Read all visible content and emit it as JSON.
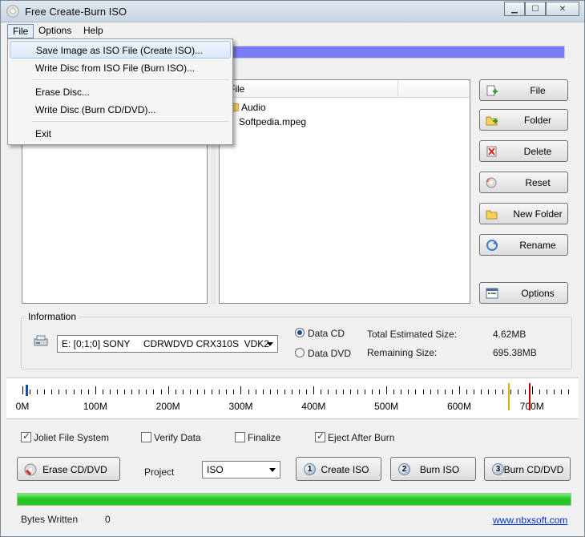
{
  "window": {
    "title": "Free Create-Burn ISO",
    "min": "▁",
    "max": "☐",
    "close": "✕"
  },
  "menu": {
    "file": "File",
    "options": "Options",
    "help": "Help"
  },
  "file_menu": {
    "items": [
      "Save Image as ISO File (Create ISO)...",
      "Write Disc from ISO File (Burn ISO)...",
      "Erase Disc...",
      "Write Disc (Burn CD/DVD)...",
      "Exit"
    ]
  },
  "file_list": {
    "header": "File",
    "items": [
      {
        "name": "Audio",
        "type": "folder"
      },
      {
        "name": "Softpedia.mpeg",
        "type": "file"
      }
    ]
  },
  "side_buttons": {
    "file": "File",
    "folder": "Folder",
    "delete": "Delete",
    "reset": "Reset",
    "new_folder": "New Folder",
    "rename": "Rename",
    "options": "Options"
  },
  "information": {
    "legend": "Information",
    "drive": "E: [0;1;0] SONY     CDRWDVD CRX310S  VDK2",
    "data_cd": "Data CD",
    "data_dvd": "Data DVD",
    "selected_media": "Data CD",
    "total_label": "Total Estimated Size:",
    "total_value": "4.62MB",
    "remaining_label": "Remaining Size:",
    "remaining_value": "695.38MB"
  },
  "ruler": {
    "labels": [
      "0M",
      "100M",
      "200M",
      "300M",
      "400M",
      "500M",
      "600M",
      "700M"
    ],
    "max_mb": 750,
    "markers": [
      {
        "mb": 667,
        "color": "#d4b400"
      },
      {
        "mb": 696,
        "color": "#c00000"
      }
    ],
    "current_mb": 4.62
  },
  "options": {
    "joliet": {
      "label": "Joliet File System",
      "checked": true
    },
    "verify": {
      "label": "Verify Data",
      "checked": false
    },
    "finalize": {
      "label": "Finalize",
      "checked": false
    },
    "eject": {
      "label": "Eject After Burn",
      "checked": true
    }
  },
  "actions": {
    "erase": "Erase CD/DVD",
    "project_label": "Project",
    "project_value": "ISO",
    "create_iso": "Create ISO",
    "create_num": "1",
    "burn_iso": "Burn ISO",
    "burn_iso_num": "2",
    "burn_cd": "Burn CD/DVD",
    "burn_cd_num": "3"
  },
  "status": {
    "bytes_label": "Bytes Written",
    "bytes_value": "0",
    "link": "www.nbxsoft.com",
    "progress": 1.0
  },
  "top_progress": {
    "progress": 1.0
  }
}
